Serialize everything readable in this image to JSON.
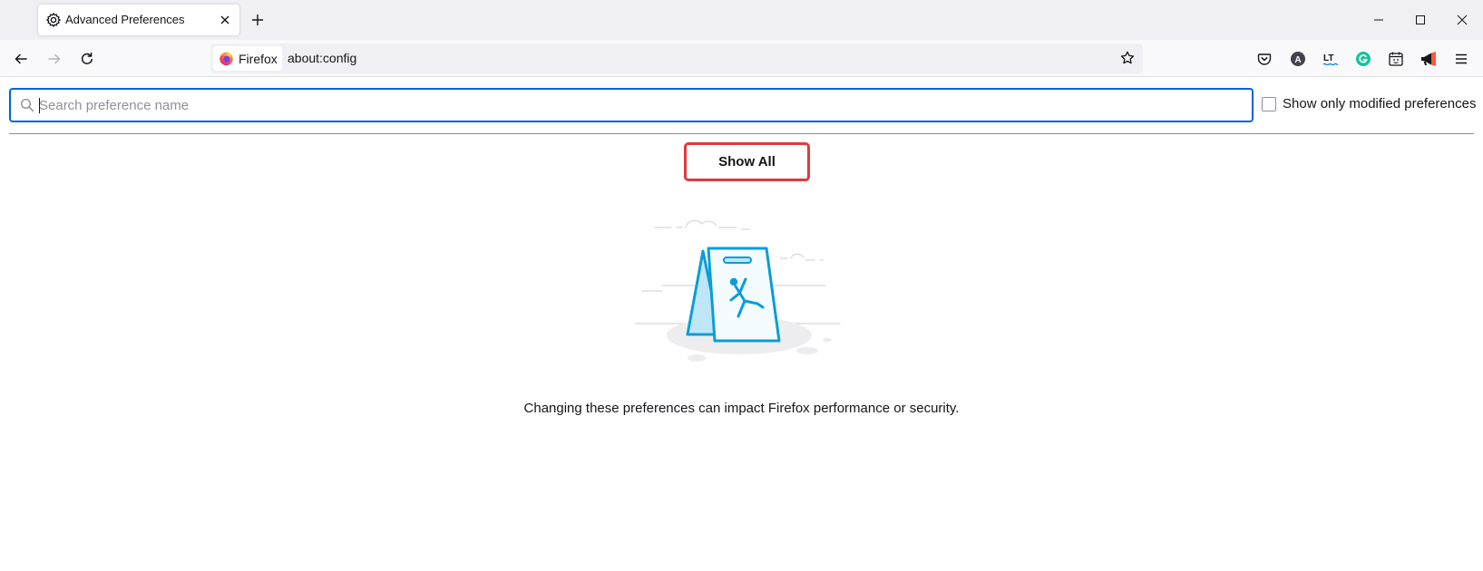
{
  "window": {
    "controls": {
      "minimize_icon": "minimize-icon",
      "maximize_icon": "maximize-icon",
      "close_icon": "close-icon"
    }
  },
  "tabs": [
    {
      "title": "Advanced Preferences",
      "icon": "gear-icon",
      "active": true
    }
  ],
  "navbar": {
    "identity_label": "Firefox",
    "url": "about:config",
    "toolbar_icons": [
      "pocket-icon",
      "account-icon",
      "languagetool-icon",
      "grammarly-icon",
      "calendar-icon",
      "megaphone-icon",
      "menu-icon"
    ]
  },
  "config": {
    "search_placeholder": "Search preference name",
    "search_value": "",
    "modified_only_label": "Show only modified preferences",
    "modified_only_checked": false,
    "show_all_label": "Show All",
    "warning_text": "Changing these preferences can impact Firefox performance or security."
  },
  "colors": {
    "accent": "#0061e0",
    "highlight_border": "#e0393e",
    "illustration_blue": "#0a9dd8"
  }
}
